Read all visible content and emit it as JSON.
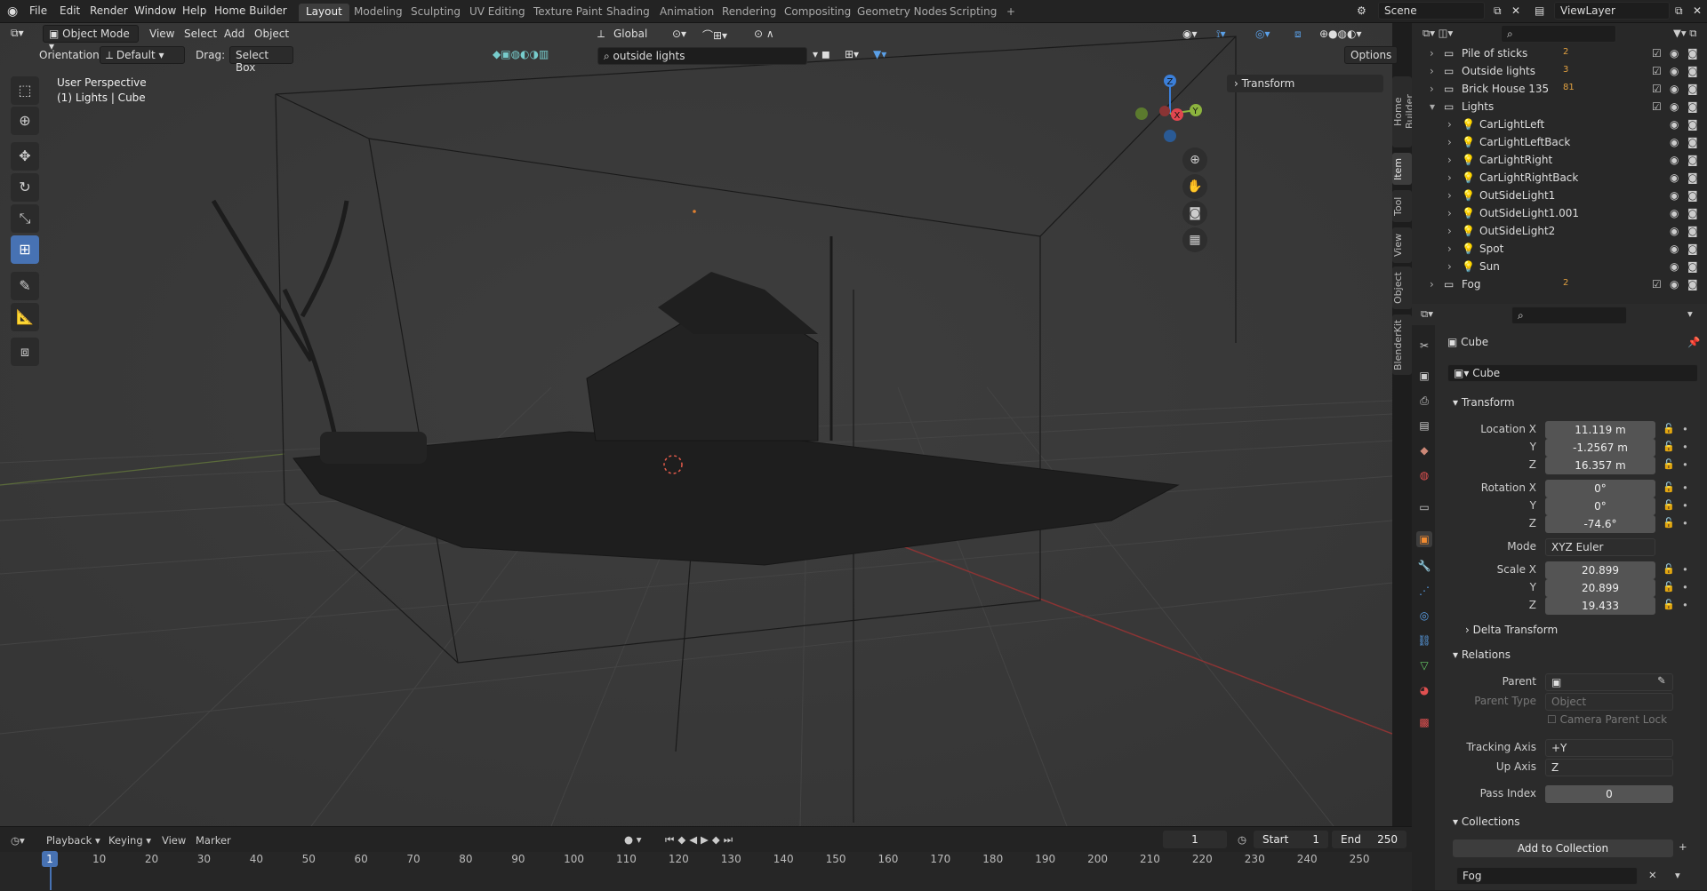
{
  "topbar": {
    "menus": [
      "File",
      "Edit",
      "Render",
      "Window",
      "Help",
      "Home Builder"
    ],
    "workspaces": [
      "Layout",
      "Modeling",
      "Sculpting",
      "UV Editing",
      "Texture Paint",
      "Shading",
      "Animation",
      "Rendering",
      "Compositing",
      "Geometry Nodes",
      "Scripting"
    ],
    "active_workspace": "Layout",
    "add_tab": "+",
    "scene": "Scene",
    "view_layer": "ViewLayer"
  },
  "viewport_header": {
    "mode": "Object Mode",
    "menus": [
      "View",
      "Select",
      "Add",
      "Object"
    ],
    "transform_orientation": "Global",
    "orientation_label": "Orientation:",
    "orientation_value": "Default",
    "drag_label": "Drag:",
    "drag_value": "Select Box",
    "search_value": "outside lights",
    "options": "Options"
  },
  "viewport": {
    "view_name": "User Perspective",
    "context": "(1) Lights | Cube",
    "transform_panel": "Transform",
    "gizmo": {
      "z": "Z",
      "x": "X",
      "y": "Y"
    }
  },
  "side_tabs": [
    "Home Builder",
    "Item",
    "Tool",
    "View",
    "Object",
    "BlenderKit"
  ],
  "outliner": {
    "rows": [
      {
        "label": "Pile of sticks",
        "indent": 0,
        "badge": "2"
      },
      {
        "label": "Outside lights",
        "indent": 0,
        "badge": "3"
      },
      {
        "label": "Brick House 135",
        "indent": 0,
        "badge": "81"
      },
      {
        "label": "Lights",
        "indent": 0,
        "badge": ""
      },
      {
        "label": "CarLightLeft",
        "indent": 1,
        "badge": ""
      },
      {
        "label": "CarLightLeftBack",
        "indent": 1,
        "badge": ""
      },
      {
        "label": "CarLightRight",
        "indent": 1,
        "badge": ""
      },
      {
        "label": "CarLightRightBack",
        "indent": 1,
        "badge": ""
      },
      {
        "label": "OutSideLight1",
        "indent": 1,
        "badge": ""
      },
      {
        "label": "OutSideLight1.001",
        "indent": 1,
        "badge": ""
      },
      {
        "label": "OutSideLight2",
        "indent": 1,
        "badge": ""
      },
      {
        "label": "Spot",
        "indent": 1,
        "badge": ""
      },
      {
        "label": "Sun",
        "indent": 1,
        "badge": ""
      },
      {
        "label": "Fog",
        "indent": 0,
        "badge": "2"
      }
    ]
  },
  "properties": {
    "object_name": "Cube",
    "data_name": "Cube",
    "transform": {
      "title": "Transform",
      "location_label": "Location X",
      "loc_x": "11.119 m",
      "loc_y": "-1.2567 m",
      "loc_z": "16.357 m",
      "rotation_label": "Rotation X",
      "rot_x": "0°",
      "rot_y": "0°",
      "rot_z": "-74.6°",
      "mode_label": "Mode",
      "mode": "XYZ Euler",
      "scale_label": "Scale X",
      "scale_x": "20.899",
      "scale_y": "20.899",
      "scale_z": "19.433",
      "y": "Y",
      "z": "Z"
    },
    "delta": "Delta Transform",
    "relations": {
      "title": "Relations",
      "parent_label": "Parent",
      "parent_type_label": "Parent Type",
      "parent_type": "Object",
      "camera_parent_lock": "Camera Parent Lock",
      "tracking_axis_label": "Tracking Axis",
      "tracking_axis": "+Y",
      "up_axis_label": "Up Axis",
      "up_axis": "Z",
      "pass_index_label": "Pass Index",
      "pass_index": "0"
    },
    "collections": {
      "title": "Collections",
      "add": "Add to Collection",
      "item": "Fog"
    }
  },
  "timeline": {
    "menus": [
      "Playback",
      "Keying",
      "View",
      "Marker"
    ],
    "current_frame": "1",
    "start_label": "Start",
    "start": "1",
    "end_label": "End",
    "end": "250",
    "ticks": [
      "10",
      "20",
      "30",
      "40",
      "50",
      "60",
      "70",
      "80",
      "90",
      "100",
      "110",
      "120",
      "130",
      "140",
      "150",
      "160",
      "170",
      "180",
      "190",
      "200",
      "210",
      "220",
      "230",
      "240",
      "250"
    ],
    "playhead": "1"
  },
  "colors": {
    "accent": "#4772b3",
    "x_axis": "#e0464f",
    "y_axis": "#8cb43e",
    "z_axis": "#3b7fd9"
  }
}
